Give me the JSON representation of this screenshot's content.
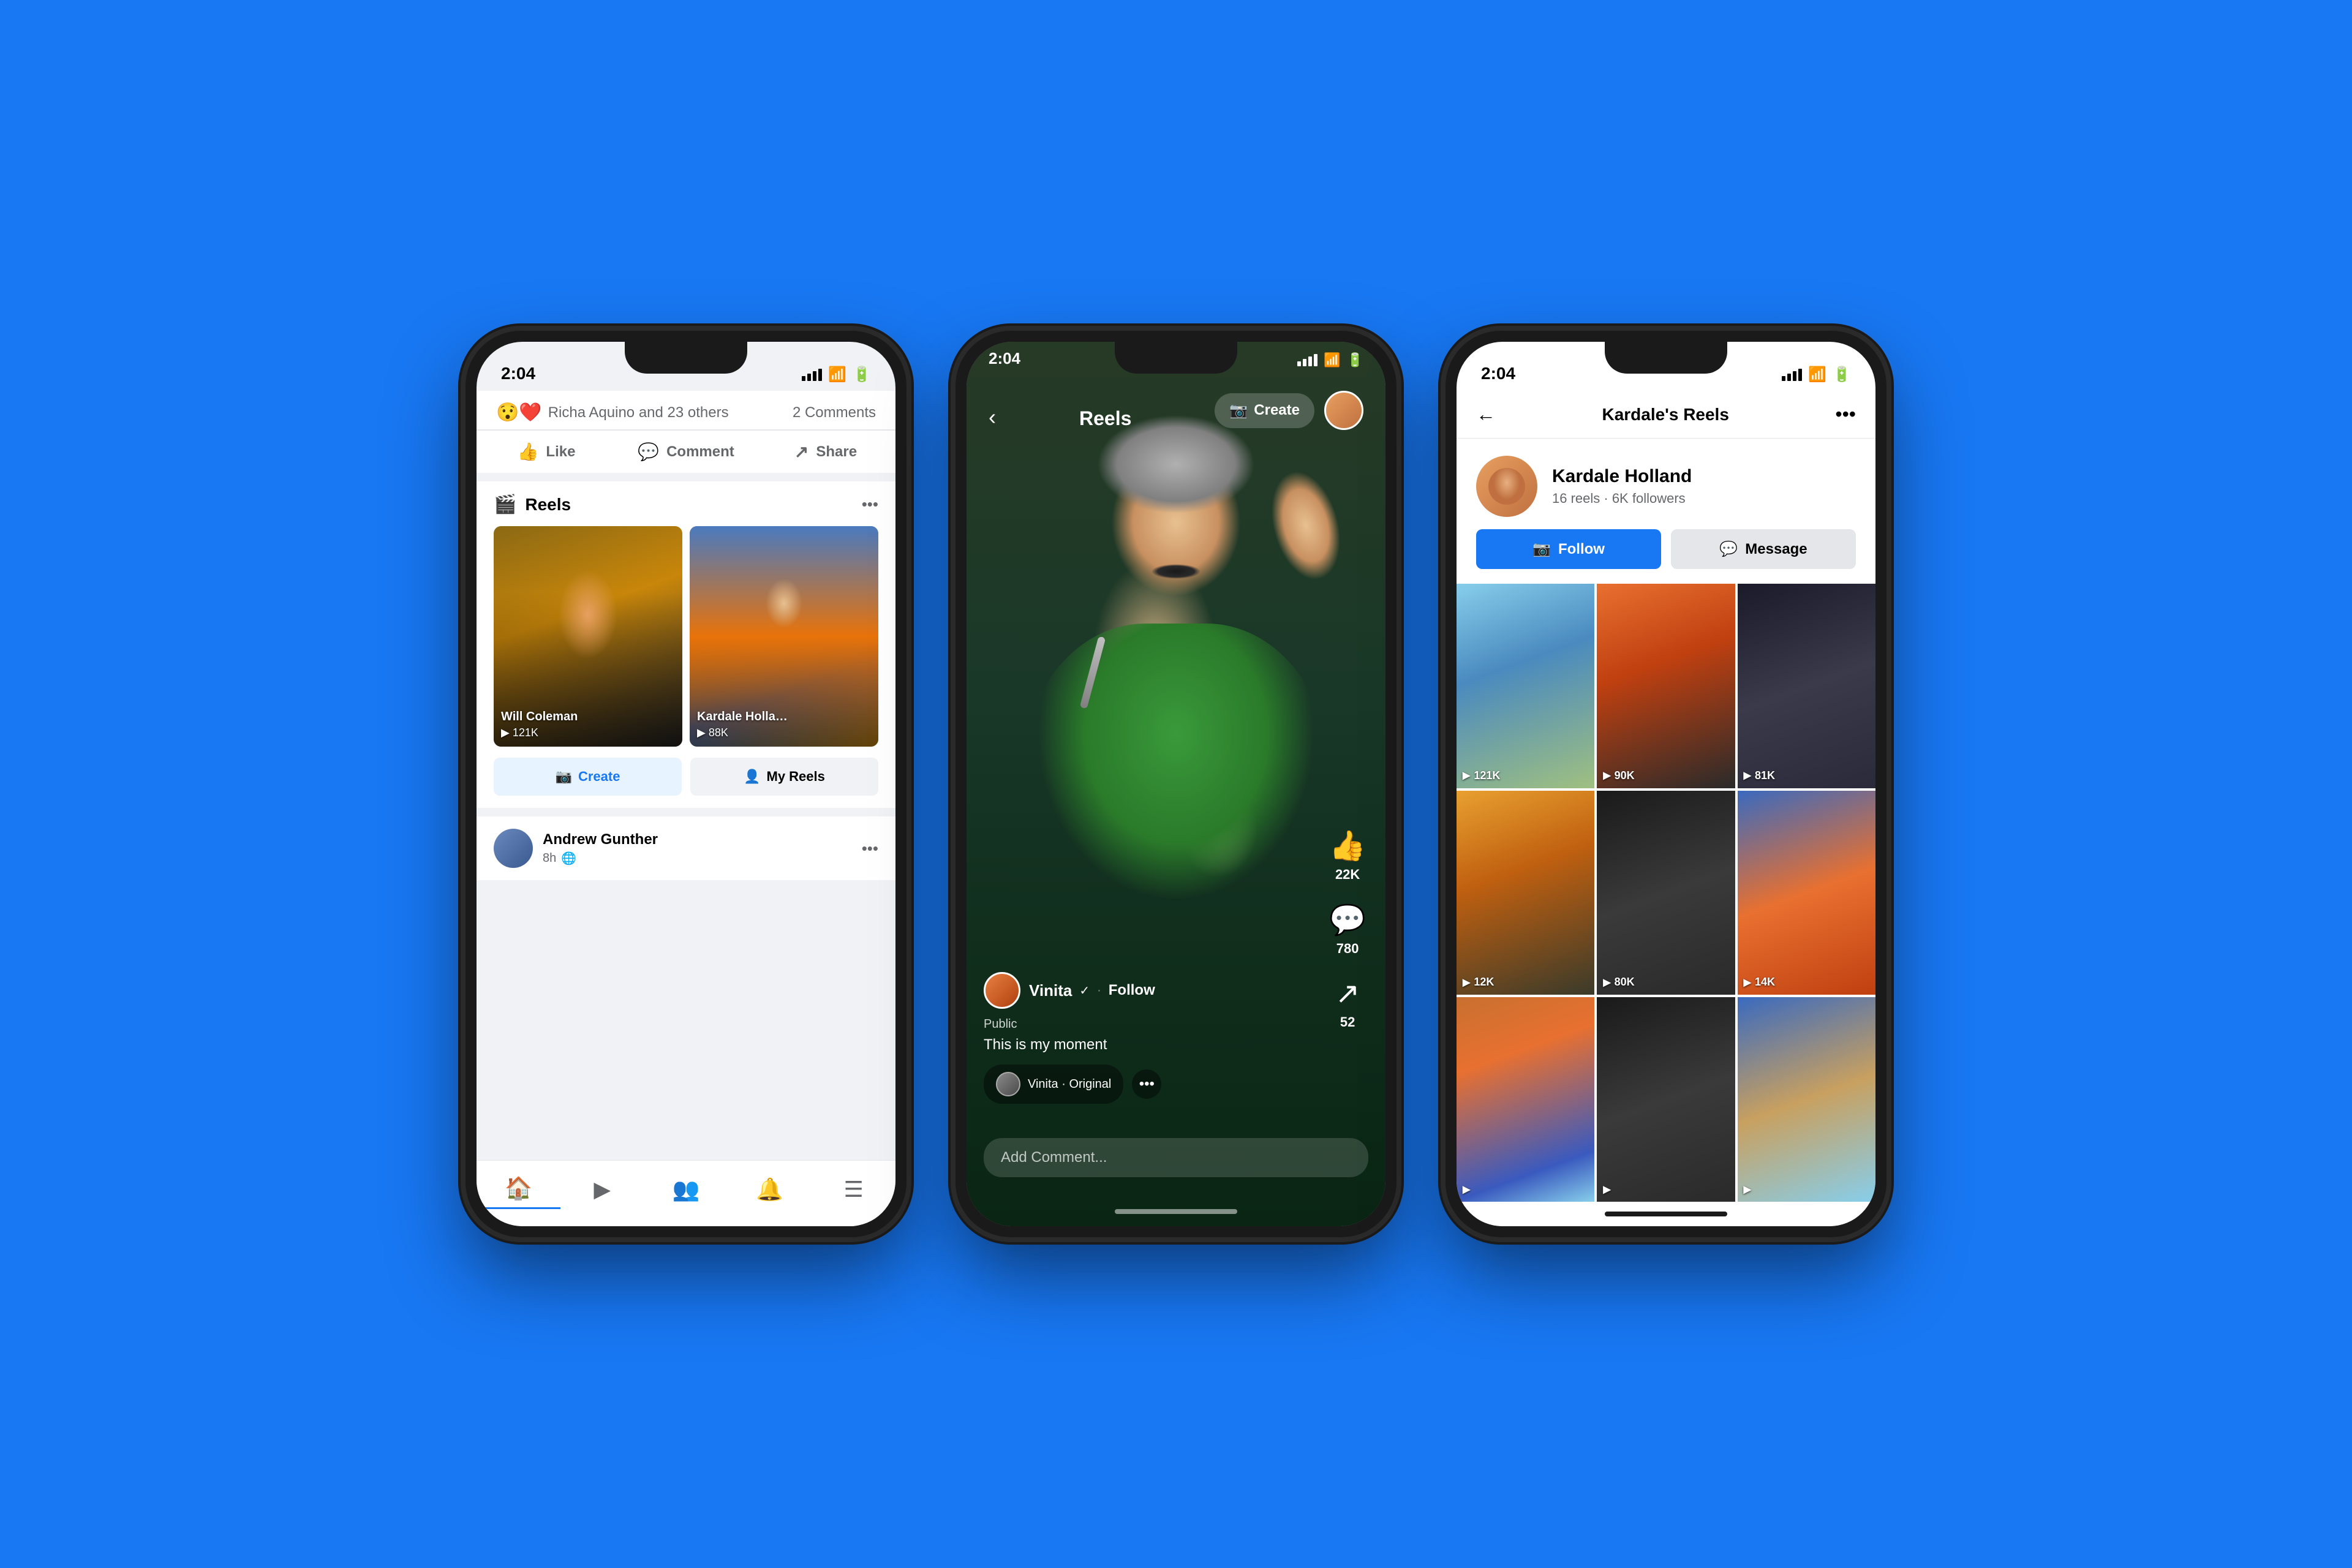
{
  "background_color": "#1877F2",
  "phones": {
    "phone1": {
      "status_time": "2:04",
      "reactions": "Richa Aquino and 23 others",
      "comments_count": "2 Comments",
      "actions": [
        "Like",
        "Comment",
        "Share"
      ],
      "reels_section_title": "Reels",
      "reels": [
        {
          "author": "Will Coleman",
          "views": "▶ 121K"
        },
        {
          "author": "Kardale Holla…",
          "views": "▶ 88K"
        }
      ],
      "create_btn": "Create",
      "my_reels_btn": "My Reels",
      "post_author": "Andrew Gunther",
      "post_time": "8h",
      "nav_items": [
        "home",
        "play",
        "users",
        "bell",
        "menu"
      ]
    },
    "phone2": {
      "status_time": "2:04",
      "header_title": "Reels",
      "create_label": "Create",
      "reel": {
        "username": "Vinita",
        "verified": true,
        "follow_label": "Follow",
        "public_label": "Public",
        "caption": "This is my moment",
        "music_label": "Vinita · Original",
        "likes": "22K",
        "comments": "780",
        "shares": "52"
      },
      "comment_placeholder": "Add Comment..."
    },
    "phone3": {
      "status_time": "2:04",
      "title": "Kardale's Reels",
      "user": {
        "name": "Kardale Holland",
        "stats": "16 reels · 6K followers"
      },
      "follow_label": "Follow",
      "message_label": "Message",
      "reels_grid": [
        {
          "views": "121K",
          "bg": "1"
        },
        {
          "views": "90K",
          "bg": "2"
        },
        {
          "views": "81K",
          "bg": "3"
        },
        {
          "views": "12K",
          "bg": "4"
        },
        {
          "views": "80K",
          "bg": "5"
        },
        {
          "views": "14K",
          "bg": "6"
        },
        {
          "views": "",
          "bg": "7"
        },
        {
          "views": "",
          "bg": "8"
        },
        {
          "views": "",
          "bg": "9"
        }
      ]
    }
  }
}
